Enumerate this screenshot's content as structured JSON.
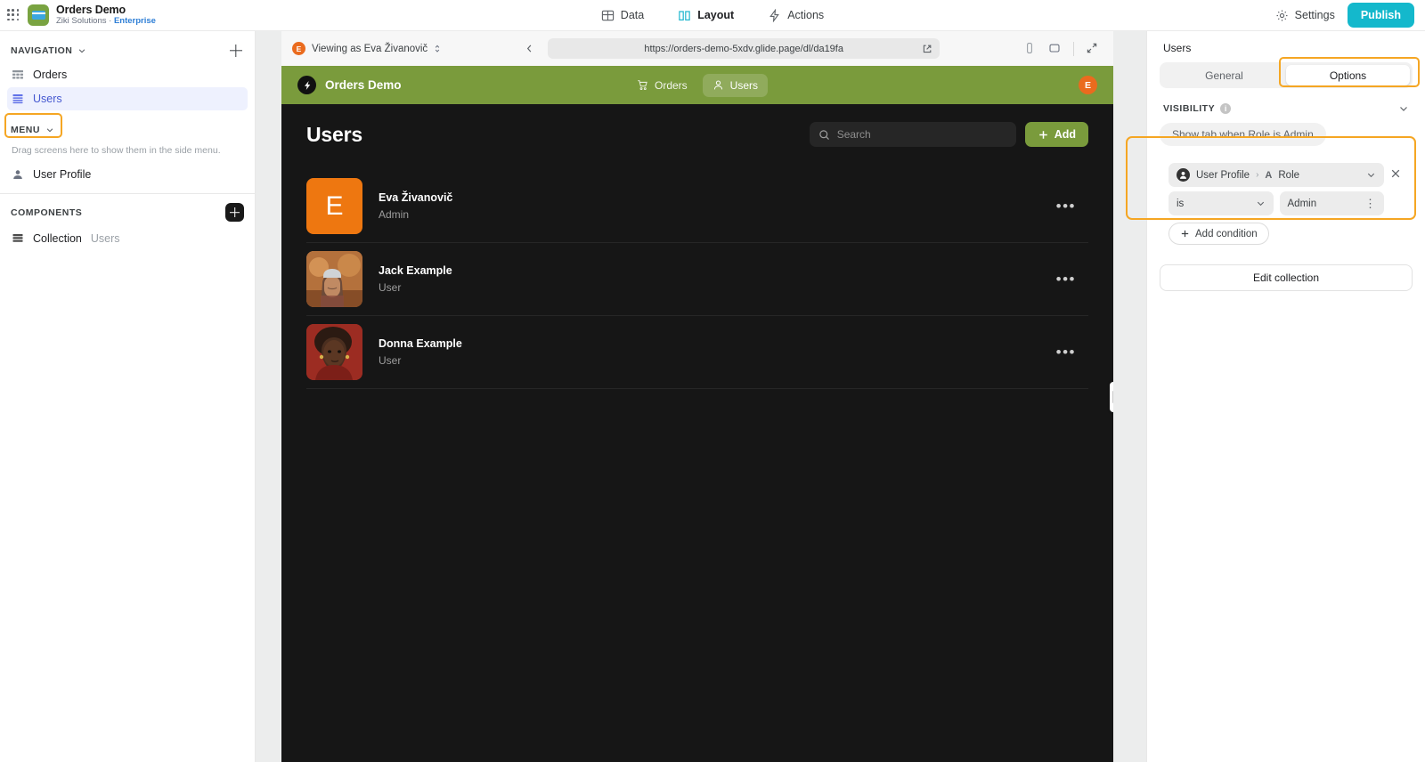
{
  "topbar": {
    "app_title": "Orders Demo",
    "org": "Ziki Solutions",
    "sep": "·",
    "plan": "Enterprise",
    "tabs": [
      {
        "label": "Data",
        "icon": "table-icon",
        "active": false
      },
      {
        "label": "Layout",
        "icon": "layout-icon",
        "active": true
      },
      {
        "label": "Actions",
        "icon": "bolt-icon",
        "active": false
      }
    ],
    "settings_label": "Settings",
    "publish_label": "Publish"
  },
  "sidebar": {
    "navigation_label": "NAVIGATION",
    "nav_items": [
      {
        "label": "Orders",
        "icon": "table-grid-icon",
        "selected": false
      },
      {
        "label": "Users",
        "icon": "list-icon",
        "selected": true
      }
    ],
    "menu_label": "MENU",
    "menu_hint": "Drag screens here to show them in the side menu.",
    "menu_items": [
      {
        "label": "User Profile",
        "icon": "person-icon"
      }
    ],
    "components_label": "COMPONENTS",
    "components": [
      {
        "label": "Collection",
        "sub": "Users",
        "icon": "collection-icon"
      }
    ]
  },
  "preview": {
    "viewing_as_label": "Viewing as Eva Živanovič",
    "viewing_as_initial": "E",
    "url": "https://orders-demo-5xdv.glide.page/dl/da19fa",
    "device_icons": [
      "phone-icon",
      "tablet-icon",
      "expand-icon"
    ],
    "app": {
      "brand": "Orders Demo",
      "tabs": [
        {
          "label": "Orders",
          "icon": "cart-icon",
          "active": false
        },
        {
          "label": "Users",
          "icon": "person-icon",
          "active": true
        }
      ],
      "avatar_initial": "E",
      "page_title": "Users",
      "search_placeholder": "Search",
      "search_value": "",
      "add_label": "Add",
      "rows": [
        {
          "name": "Eva Živanovič",
          "role": "Admin",
          "avatar_type": "initial",
          "initial": "E",
          "avatar_color": "#ee7710"
        },
        {
          "name": "Jack Example",
          "role": "User",
          "avatar_type": "photo",
          "avatar_color": "#b4663a"
        },
        {
          "name": "Donna Example",
          "role": "User",
          "avatar_type": "photo",
          "avatar_color": "#8e2b23"
        }
      ],
      "row_menu_glyph": "•••"
    }
  },
  "right_panel": {
    "title": "Users",
    "tabs": [
      {
        "label": "General",
        "active": false
      },
      {
        "label": "Options",
        "active": true
      }
    ],
    "visibility_label": "VISIBILITY",
    "visibility_info": "i",
    "visibility_pill": "Show tab when Role is Admin",
    "condition": {
      "source_label": "User Profile",
      "source_sep": "›",
      "column_type_abbr": "A",
      "column_label": "Role",
      "operator": "is",
      "value": "Admin",
      "add_condition_label": "Add condition"
    },
    "edit_collection_label": "Edit collection"
  },
  "colors": {
    "accent_highlight": "#f5a623",
    "publish": "#14b8cc",
    "app_green": "#7a9b3c",
    "selected_nav": "#4558d0",
    "orange_avatar": "#ea6b1e"
  }
}
